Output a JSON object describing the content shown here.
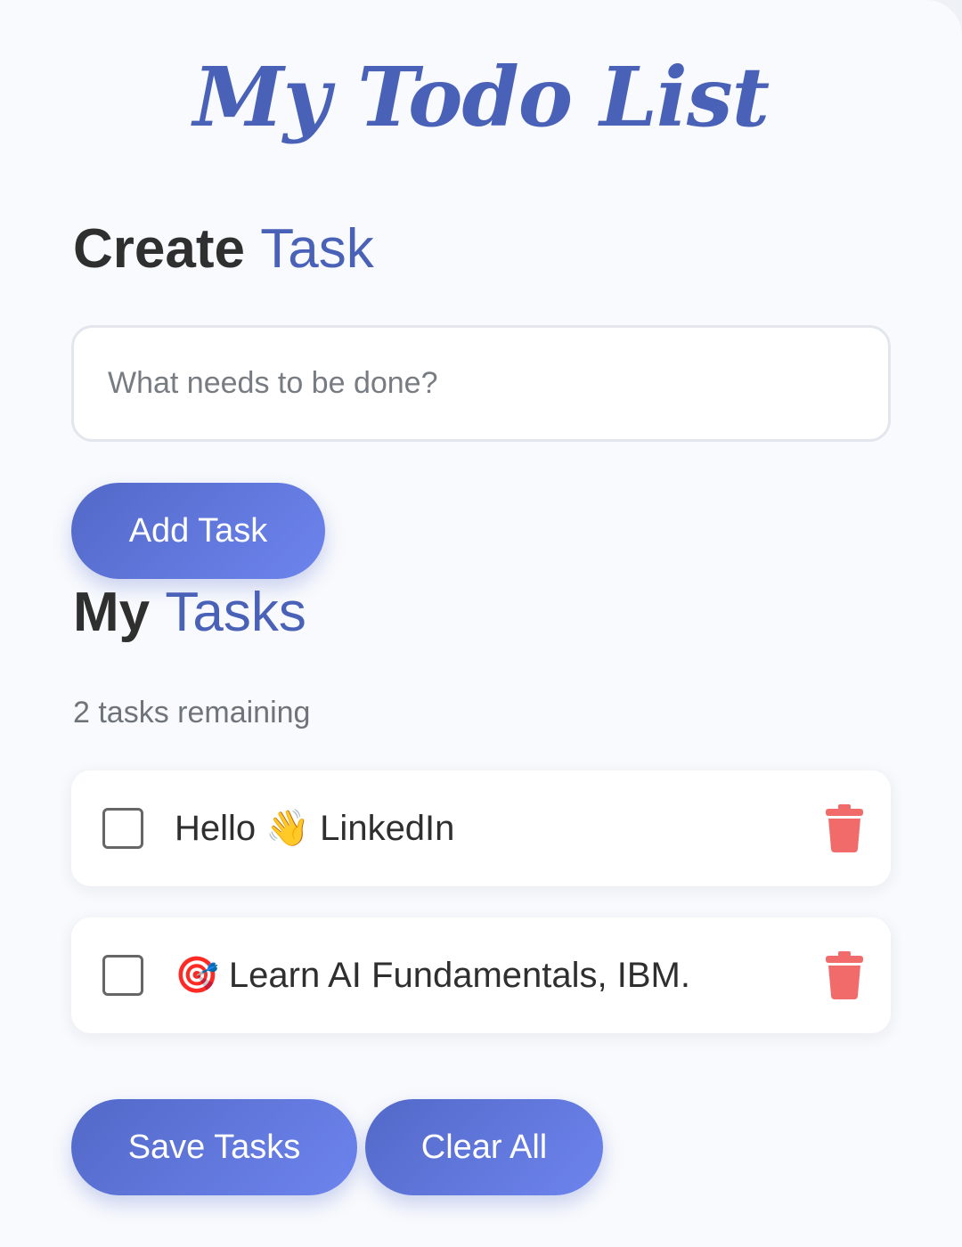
{
  "app": {
    "title": "My Todo List"
  },
  "create_section": {
    "heading_strong": "Create",
    "heading_accent": "Task",
    "input_placeholder": "What needs to be done?",
    "input_value": "",
    "add_button_label": "Add Task"
  },
  "tasks_section": {
    "heading_strong": "My",
    "heading_accent": "Tasks",
    "remaining_text": "2 tasks remaining",
    "items": [
      {
        "text": "Hello 👋 LinkedIn",
        "completed": false
      },
      {
        "text": "🎯 Learn AI Fundamentals, IBM.",
        "completed": false
      }
    ]
  },
  "footer_actions": {
    "save_label": "Save Tasks",
    "clear_label": "Clear All"
  },
  "colors": {
    "accent": "#4a61b8",
    "button_gradient_start": "#5369c8",
    "button_gradient_end": "#6d84ee",
    "delete": "#f26b6b",
    "card_background": "#f8fafd"
  },
  "icons": {
    "delete": "trash-icon",
    "checkbox": "checkbox-unchecked"
  }
}
